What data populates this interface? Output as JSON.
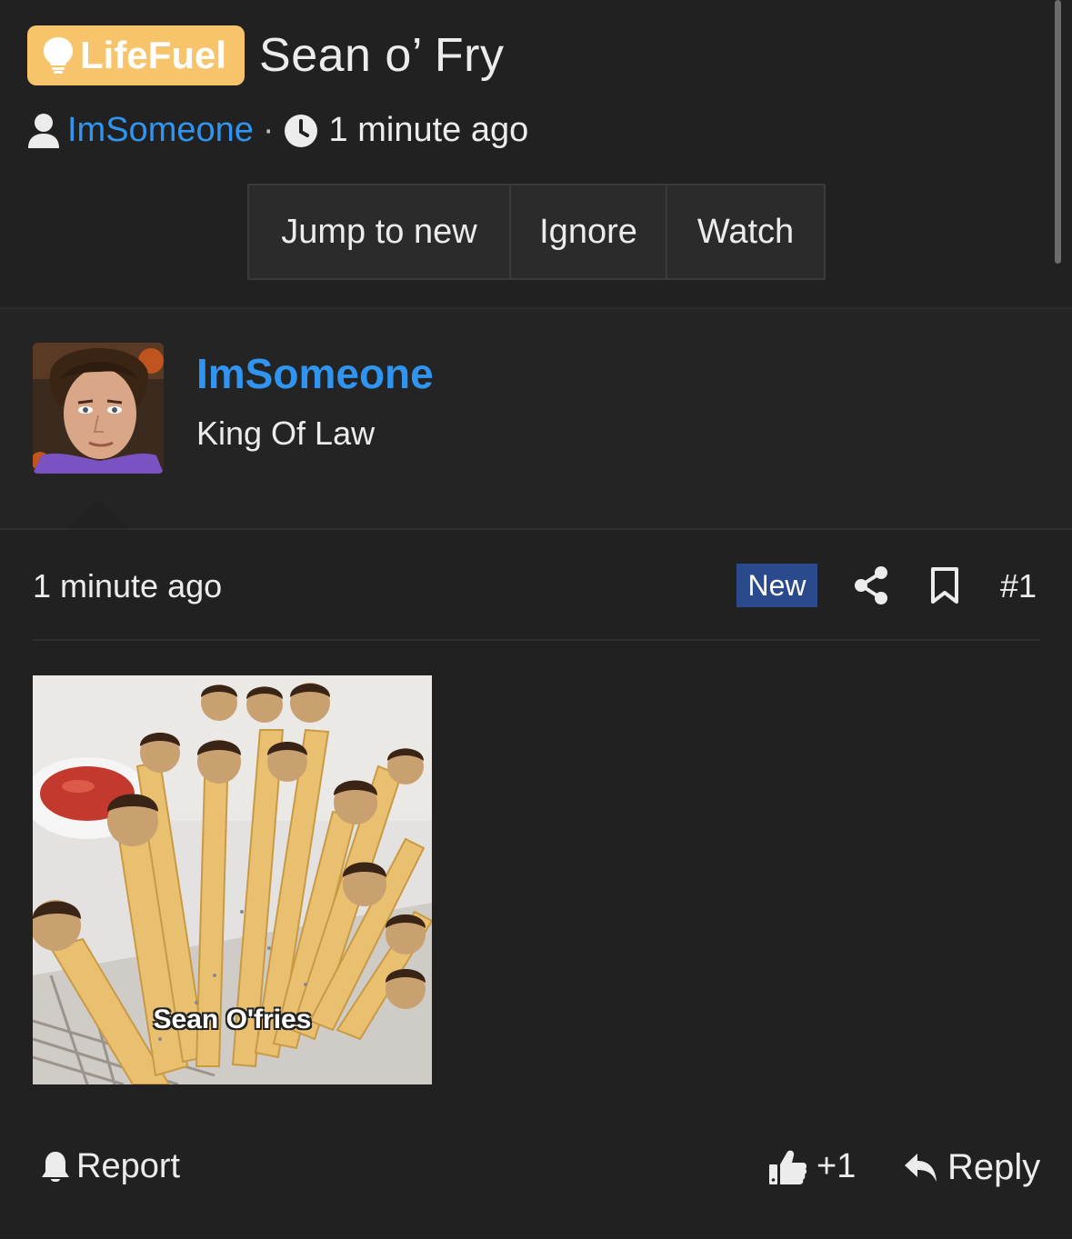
{
  "thread": {
    "prefix": "LifeFuel",
    "title": "Sean o’ Fry",
    "author": "ImSomeone",
    "separator": "·",
    "time": "1 minute ago",
    "buttons": {
      "jump_to_new": "Jump to new",
      "ignore": "Ignore",
      "watch": "Watch"
    }
  },
  "user": {
    "username": "ImSomeone",
    "user_title": "King Of Law"
  },
  "post": {
    "time": "1 minute ago",
    "new_badge": "New",
    "number": "#1",
    "image_caption": "Sean O'fries"
  },
  "actions": {
    "report": "Report",
    "like_count": "+1",
    "reply": "Reply"
  },
  "colors": {
    "background": "#212121",
    "prefix_badge": "#f7c46c",
    "link": "#2f95f0",
    "new_badge": "#2a4a8c"
  },
  "icons": {
    "prefix": "lightbulb-icon",
    "author": "user-icon",
    "time": "clock-icon",
    "share": "share-icon",
    "bookmark": "bookmark-icon",
    "report": "bell-icon",
    "like": "thumbs-up-icon",
    "reply": "reply-icon"
  }
}
